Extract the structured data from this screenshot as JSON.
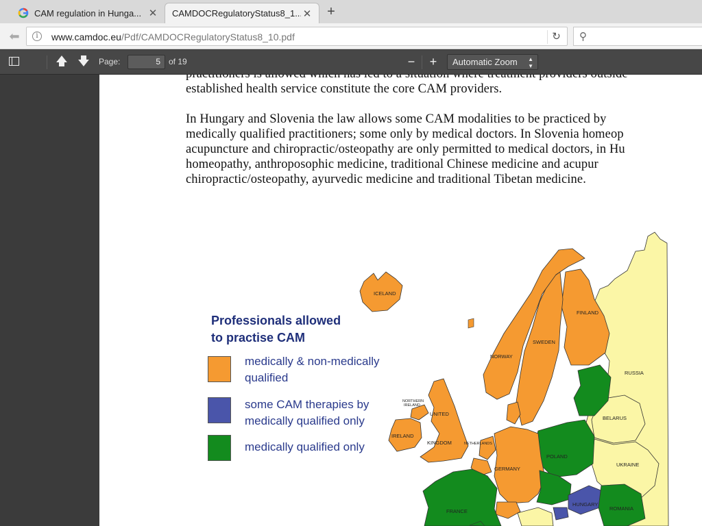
{
  "browser": {
    "tabs": [
      {
        "title": "CAM regulation in Hunga...",
        "active": false,
        "favicon": "google-g-icon"
      },
      {
        "title": "CAMDOCRegulatoryStatus8_1...",
        "active": true
      }
    ],
    "url_domain": "www.camdoc.eu",
    "url_path": "/Pdf/CAMDOCRegulatoryStatus8_10.pdf"
  },
  "pdf_toolbar": {
    "page_label": "Page:",
    "page_value": "5",
    "page_total": "of 19",
    "zoom": "Automatic Zoom"
  },
  "document": {
    "lines": [
      "practitioners is allowed which has led to a situation where treatment providers outside",
      "established health service constitute the core CAM providers.",
      "In Hungary and Slovenia the law allows some CAM modalities to be practiced by",
      "medically qualified practitioners; some only by medical doctors. In Slovenia homeop",
      "acupuncture and chiropractic/osteopathy are only permitted to medical doctors, in Hu",
      "homeopathy, anthroposophic medicine, traditional Chinese medicine and acupur",
      "chiropractic/osteopathy, ayurvedic medicine and traditional Tibetan medicine."
    ],
    "legend": {
      "title_line1": "Professionals allowed",
      "title_line2": "to practise CAM",
      "items": [
        {
          "line1": "medically & non-medically",
          "line2": "qualified",
          "color": "#f59a31"
        },
        {
          "line1": "some CAM therapies by",
          "line2": "medically qualified  only",
          "color": "#4a55aa"
        },
        {
          "line1": "medically qualified  only",
          "line2": "",
          "color": "#138b1e"
        }
      ]
    },
    "map_labels": {
      "iceland": "ICELAND",
      "finland": "FINLAND",
      "sweden": "SWEDEN",
      "norway": "NORWAY",
      "russia": "RUSSIA",
      "belarus": "BELARUS",
      "ukraine": "UKRAINE",
      "poland": "POLAND",
      "germany": "GERMANY",
      "netherlands": "NETHERLANDS",
      "united_kingdom_1": "UNITED",
      "united_kingdom_2": "KINGDOM",
      "ireland": "IRELAND",
      "northern_ireland_1": "NORTHERN",
      "northern_ireland_2": "IRELAND",
      "france": "FRANCE",
      "hungary": "HUNGARY",
      "romania": "ROMANIA"
    },
    "colors": {
      "orange": "#f59a31",
      "blue": "#4a55aa",
      "green": "#138b1e",
      "yellow": "#fbf6a6"
    }
  }
}
